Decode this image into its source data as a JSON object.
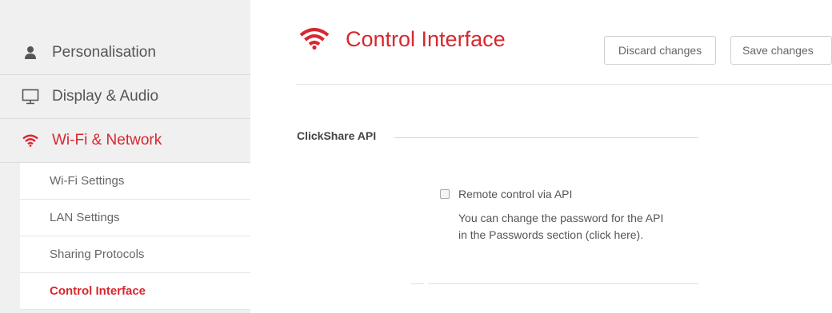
{
  "sidebar": {
    "items": [
      {
        "label": "Personalisation",
        "icon": "person-icon"
      },
      {
        "label": "Display & Audio",
        "icon": "monitor-icon"
      },
      {
        "label": "Wi-Fi & Network",
        "icon": "wifi-icon",
        "active": true
      }
    ],
    "subitems": [
      {
        "label": "Wi-Fi Settings"
      },
      {
        "label": "LAN Settings"
      },
      {
        "label": "Sharing Protocols"
      },
      {
        "label": "Control Interface",
        "active": true
      }
    ]
  },
  "header": {
    "title": "Control Interface",
    "icon": "wifi-icon",
    "discard_label": "Discard changes",
    "save_label": "Save changes"
  },
  "section": {
    "title": "ClickShare API",
    "checkbox_label": "Remote control via API",
    "checkbox_checked": false,
    "help_line1": "You can change the password for the API",
    "help_line2": "in the Passwords section (click here)."
  },
  "colors": {
    "accent": "#d7282f",
    "sidebar_bg": "#f0f0f0",
    "text": "#555555"
  }
}
